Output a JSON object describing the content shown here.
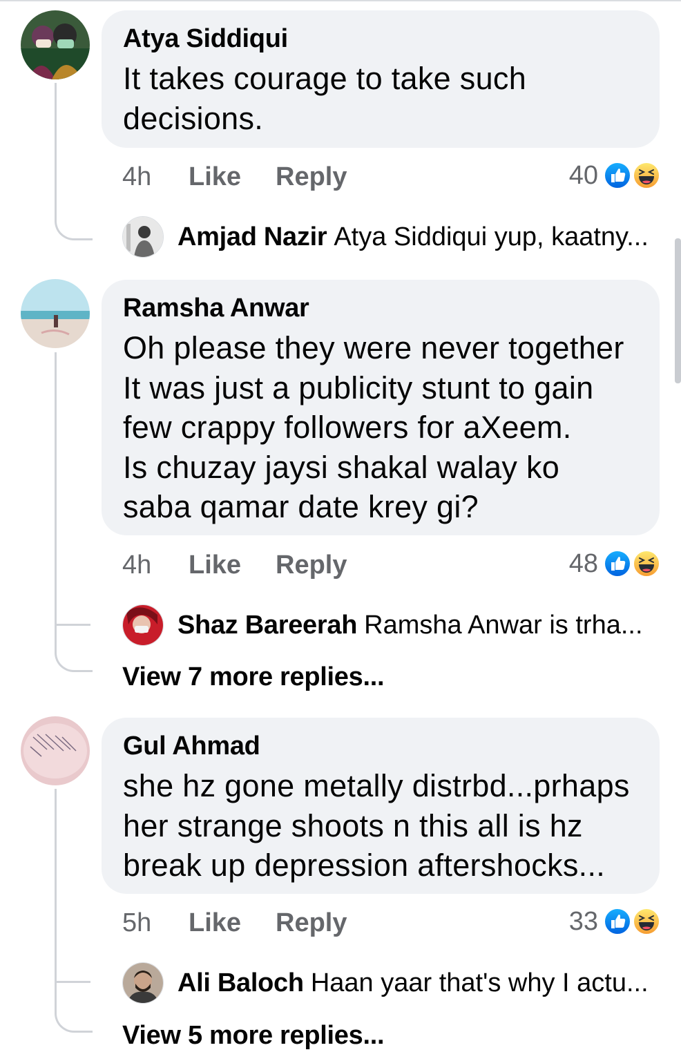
{
  "colors": {
    "bubble": "#f0f2f5",
    "meta_text": "#65676b",
    "like_blue": "#1b74e4",
    "haha_yellow": "#f7b125"
  },
  "comments": [
    {
      "author": "Atya Siddiqui",
      "text": "It takes courage to take such decisions.",
      "time": "4h",
      "like_label": "Like",
      "reply_label": "Reply",
      "reaction_count": "40",
      "reactions": [
        "like-icon",
        "haha-icon"
      ],
      "replies": [
        {
          "author": "Amjad Nazir",
          "text": "Atya Siddiqui yup, kaatny..."
        }
      ],
      "more_replies": ""
    },
    {
      "author": "Ramsha Anwar",
      "text": "Oh please they were never together\nIt was just a publicity stunt to gain few crappy followers for aXeem.\nIs chuzay jaysi shakal walay ko saba qamar date krey gi?",
      "time": "4h",
      "like_label": "Like",
      "reply_label": "Reply",
      "reaction_count": "48",
      "reactions": [
        "like-icon",
        "haha-icon"
      ],
      "replies": [
        {
          "author": "Shaz Bareerah",
          "text": "Ramsha Anwar  is trha..."
        }
      ],
      "more_replies": "View 7 more replies..."
    },
    {
      "author": "Gul Ahmad",
      "text": "she hz gone metally distrbd...prhaps her strange shoots n this all is hz break up depression aftershocks...",
      "time": "5h",
      "like_label": "Like",
      "reply_label": "Reply",
      "reaction_count": "33",
      "reactions": [
        "like-icon",
        "haha-icon"
      ],
      "replies": [
        {
          "author": "Ali Baloch",
          "text": "Haan yaar that's why I actu..."
        }
      ],
      "more_replies": "View 5 more replies..."
    }
  ]
}
